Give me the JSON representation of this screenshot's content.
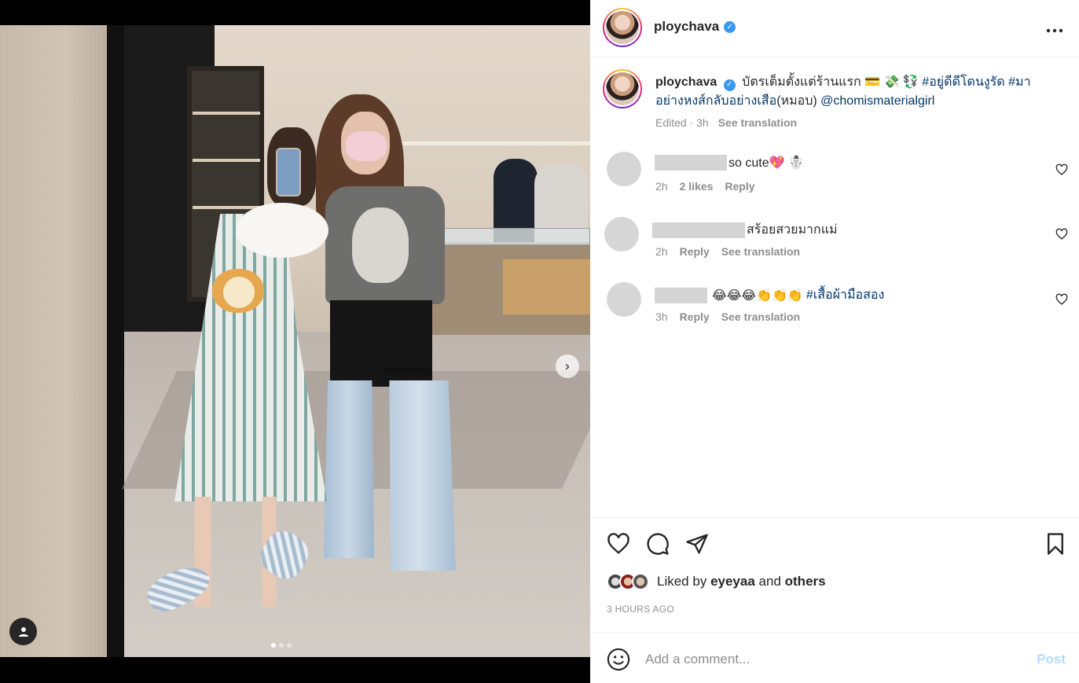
{
  "post": {
    "username": "ploychava",
    "verified": true
  },
  "caption": {
    "username": "ploychava",
    "text_1": "บัตรเต็มตั้งแต่ร้านแรก 💳 💸 💱",
    "hashtag_1": "#อยู่ดีดีโดนงูรัด",
    "hashtag_2": "#มาอย่างหงส์กลับอย่างเสือ",
    "text_2": "(หมอบ)",
    "mention": "@chomismaterialgirl",
    "edited": "Edited · 3h",
    "see_translation": "See translation"
  },
  "comments": [
    {
      "text": "so cute💖 ☃️",
      "time": "2h",
      "likes": "2 likes",
      "reply": "Reply",
      "translation": ""
    },
    {
      "text": "สร้อยสวยมากแม่",
      "time": "2h",
      "likes": "",
      "reply": "Reply",
      "translation": "See translation"
    },
    {
      "text": "😂😂😂👏👏👏",
      "hashtag": "#เสื้อผ้ามือสอง",
      "time": "3h",
      "likes": "",
      "reply": "Reply",
      "translation": "See translation"
    }
  ],
  "likes": {
    "prefix": "Liked by",
    "user": "eyeyaa",
    "joiner": "and",
    "others": "others"
  },
  "timestamp": "3 HOURS AGO",
  "add_comment": {
    "placeholder": "Add a comment...",
    "post_label": "Post"
  },
  "colors": {
    "link": "#00376b",
    "verified": "#3897f0",
    "post_disabled": "#b3dbff",
    "meta": "#8e8e8e"
  },
  "icons": [
    "heart-icon",
    "comment-icon",
    "share-icon",
    "bookmark-icon",
    "emoji-icon",
    "more-icon",
    "chevron-right-icon",
    "user-tag-icon"
  ]
}
